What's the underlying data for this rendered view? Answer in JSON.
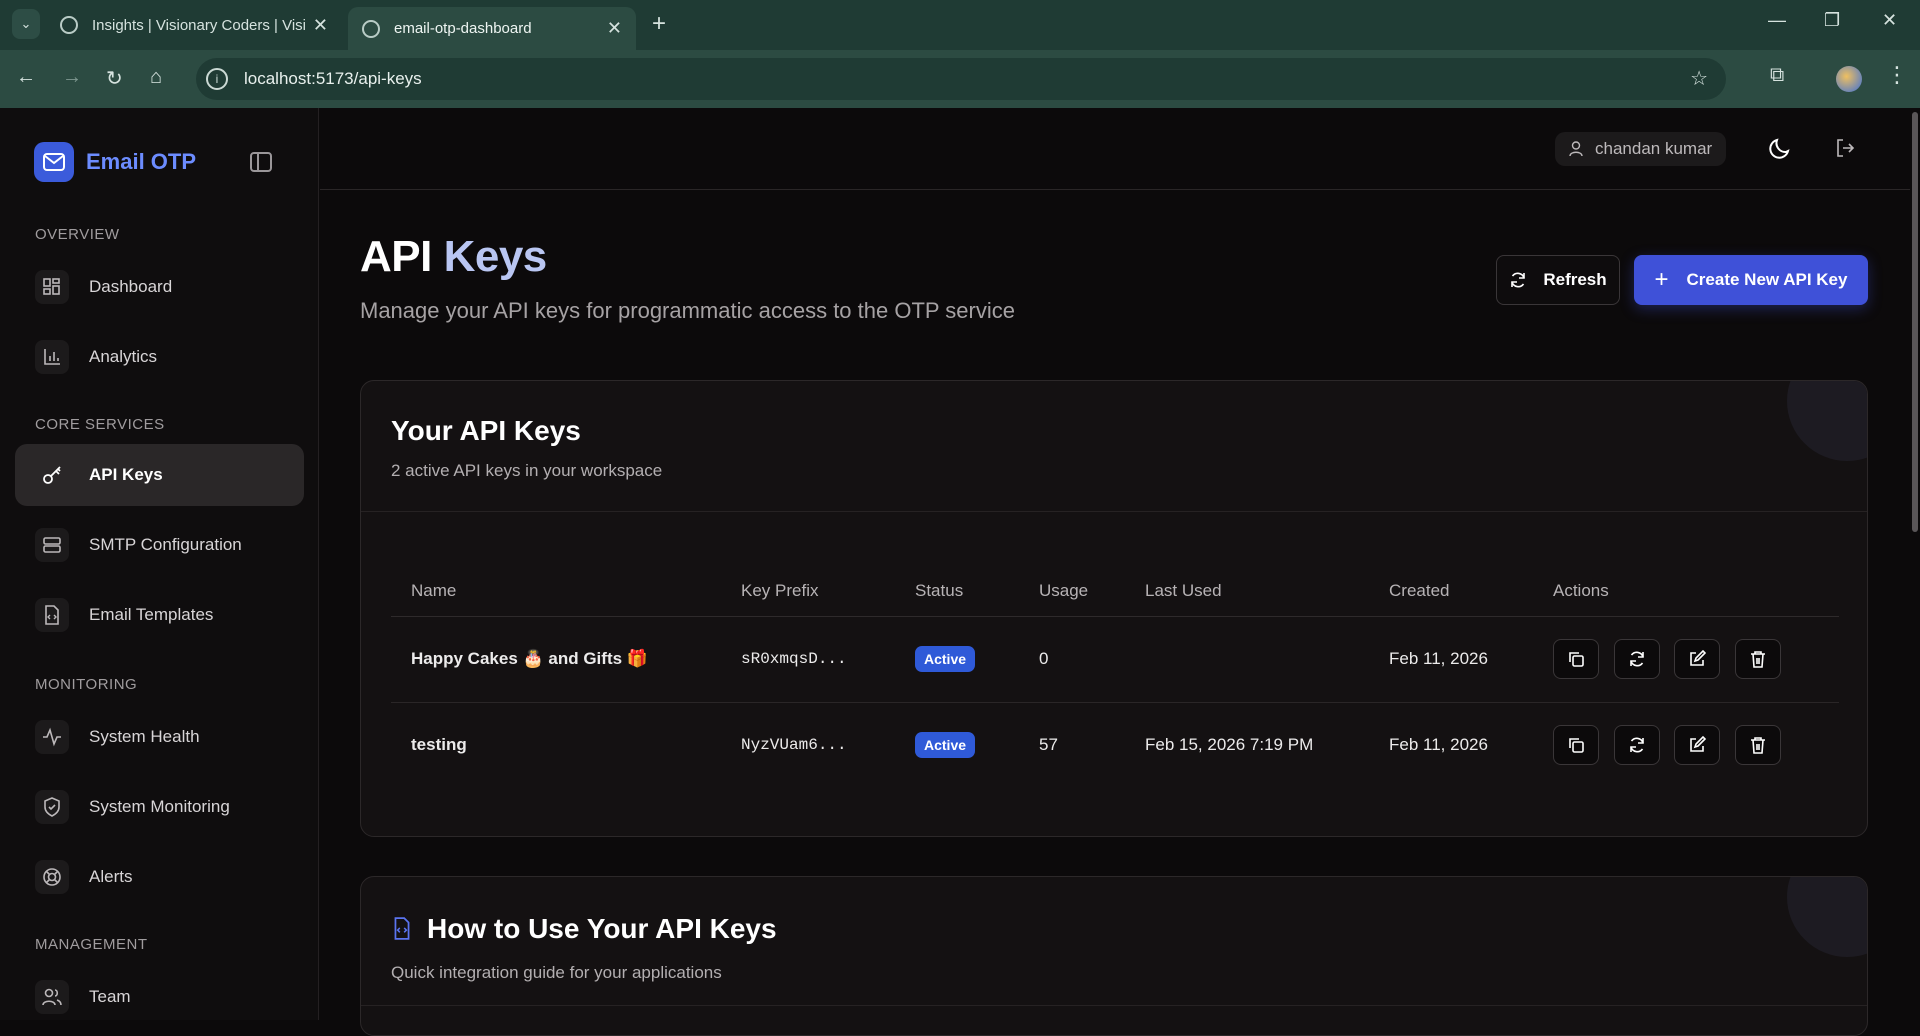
{
  "browser": {
    "tabs": [
      {
        "title": "Insights | Visionary Coders | Visi"
      },
      {
        "title": "email-otp-dashboard"
      }
    ],
    "url": "localhost:5173/api-keys"
  },
  "sidebar": {
    "brand": "Email OTP",
    "sections": {
      "overview": "OVERVIEW",
      "core": "CORE SERVICES",
      "monitoring": "MONITORING",
      "management": "MANAGEMENT"
    },
    "items": {
      "dashboard": "Dashboard",
      "analytics": "Analytics",
      "api_keys": "API Keys",
      "smtp": "SMTP Configuration",
      "templates": "Email Templates",
      "health": "System Health",
      "monitoring": "System Monitoring",
      "alerts": "Alerts",
      "team": "Team"
    }
  },
  "header": {
    "user": "chandan kumar"
  },
  "page": {
    "title_main": "API",
    "title_accent": "Keys",
    "subtitle": "Manage your API keys for programmatic access to the OTP service",
    "refresh_label": "Refresh",
    "create_label": "Create New API Key",
    "create_plus": "+"
  },
  "keys_card": {
    "title": "Your API Keys",
    "subtitle": "2 active API keys in your workspace",
    "columns": {
      "name": "Name",
      "prefix": "Key Prefix",
      "status": "Status",
      "usage": "Usage",
      "last_used": "Last Used",
      "created": "Created",
      "actions": "Actions"
    },
    "rows": [
      {
        "name": "Happy Cakes 🎂 and Gifts 🎁",
        "prefix": "sR0xmqsD...",
        "status": "Active",
        "usage": "0",
        "last_used": "",
        "created": "Feb 11, 2026"
      },
      {
        "name": "testing",
        "prefix": "NyzVUam6...",
        "status": "Active",
        "usage": "57",
        "last_used": "Feb 15, 2026 7:19 PM",
        "created": "Feb 11, 2026"
      }
    ]
  },
  "guide_card": {
    "title": "How to Use Your API Keys",
    "subtitle": "Quick integration guide for your applications"
  },
  "colors": {
    "accent": "#3f51d8",
    "badge": "#2f5ad8",
    "brand_text": "#6c8cff"
  }
}
